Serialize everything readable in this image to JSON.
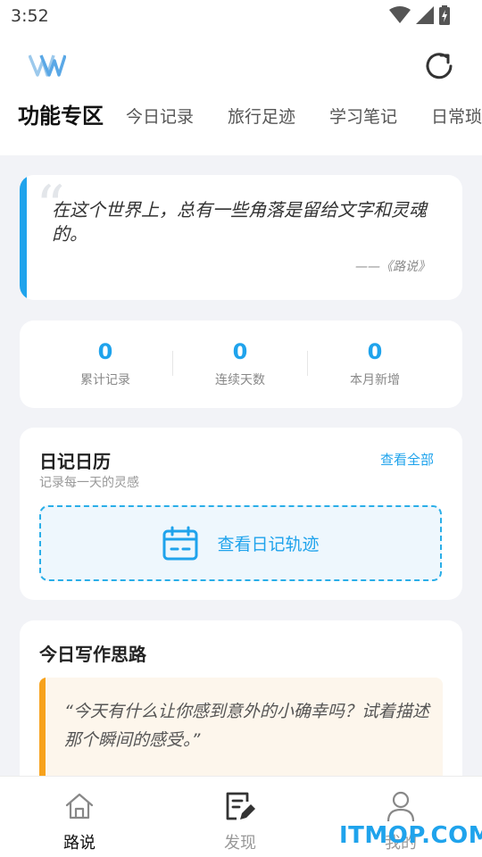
{
  "status_bar": {
    "time": "3:52"
  },
  "header": {
    "tabs": [
      "功能专区",
      "今日记录",
      "旅行足迹",
      "学习笔记",
      "日常琐"
    ]
  },
  "quote_card": {
    "text": "在这个世界上，总有一些角落是留给文字和灵魂的。",
    "source": "——《路说》"
  },
  "stats": [
    {
      "value": "0",
      "label": "累计记录"
    },
    {
      "value": "0",
      "label": "连续天数"
    },
    {
      "value": "0",
      "label": "本月新增"
    }
  ],
  "calendar_card": {
    "title": "日记日历",
    "subtitle": "记录每一天的灵感",
    "view_all": "查看全部",
    "track_label": "查看日记轨迹"
  },
  "idea_card": {
    "title": "今日写作思路",
    "prompt": "“今天有什么让你感到意外的小确幸吗？试着描述那个瞬间的感受。”"
  },
  "bottom_nav": [
    {
      "label": "路说",
      "icon": "home-icon",
      "active": true
    },
    {
      "label": "发现",
      "icon": "edit-note-icon",
      "active": false
    },
    {
      "label": "我的",
      "icon": "user-icon",
      "active": false
    }
  ],
  "watermark": "ITMOP.COM",
  "colors": {
    "accent": "#1fa3ec",
    "idea_accent": "#f7a21c"
  }
}
